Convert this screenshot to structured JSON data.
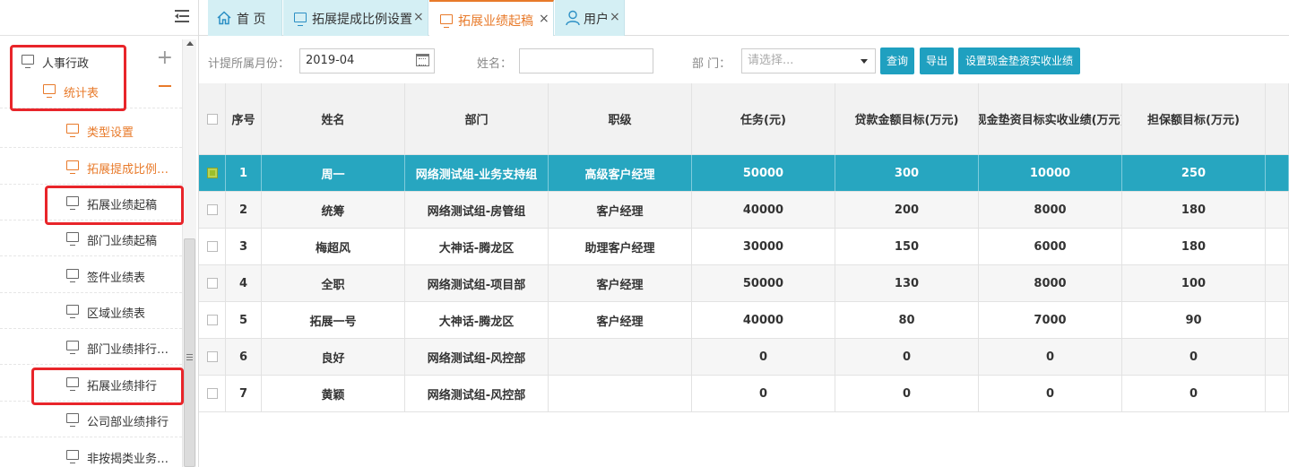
{
  "sidebar": {
    "items": [
      {
        "label": "人事行政",
        "level": 0,
        "color": "#333333",
        "control": "expand",
        "control_glyph": "+"
      },
      {
        "label": "统计表",
        "level": 1,
        "color": "#e87a2a",
        "control": "collapse"
      },
      {
        "label": "类型设置",
        "level": 2,
        "color": "#e87a2a"
      },
      {
        "label": "拓展提成比例设置",
        "level": 2,
        "color": "#e87a2a"
      },
      {
        "label": "拓展业绩起稿",
        "level": 2,
        "color": "#333333"
      },
      {
        "label": "部门业绩起稿",
        "level": 2,
        "color": "#333333"
      },
      {
        "label": "签件业绩表",
        "level": 2,
        "color": "#333333"
      },
      {
        "label": "区域业绩表",
        "level": 2,
        "color": "#333333"
      },
      {
        "label": "部门业绩排行(部门)",
        "level": 2,
        "color": "#333333"
      },
      {
        "label": "拓展业绩排行",
        "level": 2,
        "color": "#333333"
      },
      {
        "label": "公司部业绩排行",
        "level": 2,
        "color": "#333333"
      },
      {
        "label": "非按揭类业务统计",
        "level": 2,
        "color": "#333333"
      }
    ]
  },
  "tabs": [
    {
      "label": "首 页",
      "icon": "home-icon",
      "closable": false,
      "active": false
    },
    {
      "label": "拓展提成比例设置",
      "icon": "monitor-icon",
      "closable": true,
      "active": false
    },
    {
      "label": "拓展业绩起稿",
      "icon": "monitor-icon",
      "closable": true,
      "active": true
    },
    {
      "label": "用户",
      "icon": "user-icon",
      "closable": true,
      "active": false
    }
  ],
  "tab_close_glyph": "×",
  "filters": {
    "month_label": "计提所属月份：",
    "month_value": "2019-04",
    "name_label": "姓名：",
    "name_value": "",
    "dept_label": "部 门：",
    "dept_placeholder": "请选择...",
    "buttons": [
      "查询",
      "导出",
      "设置现金垫资实收业绩"
    ]
  },
  "table": {
    "headers": [
      "序号",
      "姓名",
      "部门",
      "职级",
      "任务(元)",
      "贷款金额目标(万元)",
      "现金垫资目标实收业绩(万元)",
      "担保额目标(万元)"
    ],
    "rows": [
      {
        "no": "1",
        "name": "周一",
        "dept": "网络测试组-业务支持组",
        "rank": "高级客户经理",
        "task": "50000",
        "loan": "300",
        "cash": "10000",
        "guarantee": "250",
        "selected": true
      },
      {
        "no": "2",
        "name": "统筹",
        "dept": "网络测试组-房管组",
        "rank": "客户经理",
        "task": "40000",
        "loan": "200",
        "cash": "8000",
        "guarantee": "180",
        "selected": false
      },
      {
        "no": "3",
        "name": "梅超风",
        "dept": "大神话-腾龙区",
        "rank": "助理客户经理",
        "task": "30000",
        "loan": "150",
        "cash": "6000",
        "guarantee": "180",
        "selected": false
      },
      {
        "no": "4",
        "name": "全职",
        "dept": "网络测试组-项目部",
        "rank": "客户经理",
        "task": "50000",
        "loan": "130",
        "cash": "8000",
        "guarantee": "100",
        "selected": false
      },
      {
        "no": "5",
        "name": "拓展一号",
        "dept": "大神话-腾龙区",
        "rank": "客户经理",
        "task": "40000",
        "loan": "80",
        "cash": "7000",
        "guarantee": "90",
        "selected": false
      },
      {
        "no": "6",
        "name": "良好",
        "dept": "网络测试组-风控部",
        "rank": "",
        "task": "0",
        "loan": "0",
        "cash": "0",
        "guarantee": "0",
        "selected": false
      },
      {
        "no": "7",
        "name": "黄颖",
        "dept": "网络测试组-风控部",
        "rank": "",
        "task": "0",
        "loan": "0",
        "cash": "0",
        "guarantee": "0",
        "selected": false
      }
    ]
  },
  "colors": {
    "accent_orange": "#e87a2a",
    "teal": "#27a6c0",
    "highlight_red": "#e8252a"
  }
}
